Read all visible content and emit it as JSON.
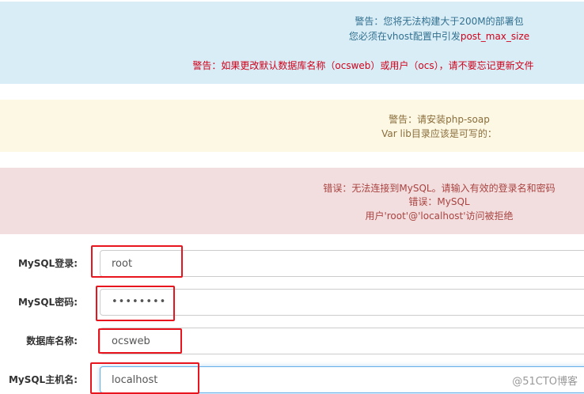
{
  "alerts": {
    "info": {
      "line1": "警告：您将无法构建大于200M的部署包",
      "line2_prefix": "您必须在vhost配置中引发",
      "line2_highlight": "post_max_size",
      "line4": "警告：如果更改默认数据库名称（ocsweb）或用户（ocs），请不要忘记更新文件"
    },
    "warn": {
      "line1": "警告：请安装php-soap",
      "line2": "Var lib目录应该是可写的："
    },
    "danger": {
      "line1": "错误：无法连接到MySQL。请输入有效的登录名和密码",
      "line2": "错误：MySQL",
      "line3": "用户'root'@'localhost'访问被拒绝"
    }
  },
  "form": {
    "login_label": "MySQL登录:",
    "login_value": "root",
    "password_label": "MySQL密码:",
    "password_value": "••••••••",
    "dbname_label": "数据库名称:",
    "dbname_value": "ocsweb",
    "host_label": "MySQL主机名:",
    "host_value": "localhost"
  },
  "watermark": "@51CTO博客",
  "colors": {
    "info_bg": "#d9edf7",
    "warn_bg": "#fcf8e3",
    "danger_bg": "#f2dede",
    "highlight_red": "#e8141e"
  }
}
